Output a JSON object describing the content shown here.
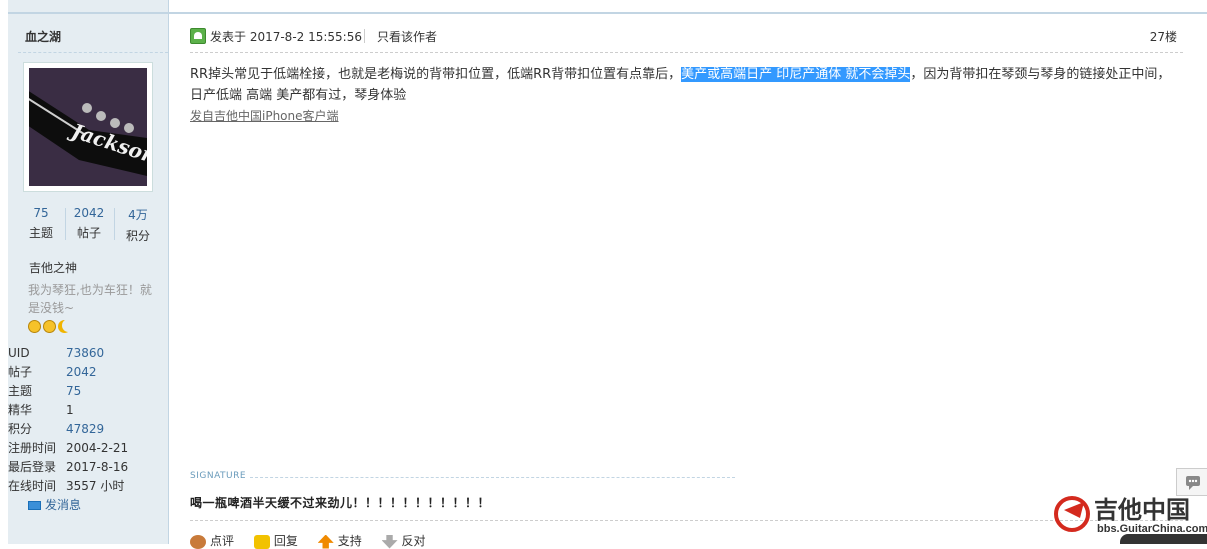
{
  "sidebar": {
    "username": "血之湖",
    "stats": [
      {
        "value": "75",
        "label": "主题"
      },
      {
        "value": "2042",
        "label": "帖子"
      },
      {
        "value": "4万",
        "label": "积分"
      }
    ],
    "rank": "吉他之神",
    "motto": "我为琴狂,也为车狂！就是没钱~",
    "avatar_text": "Jackson",
    "info": [
      {
        "key": "UID",
        "value": "73860"
      },
      {
        "key": "帖子",
        "value": "2042"
      },
      {
        "key": "主题",
        "value": "75"
      },
      {
        "key": "精华",
        "value": "1"
      },
      {
        "key": "积分",
        "value": "47829"
      },
      {
        "key": "注册时间",
        "value": "2004-2-21"
      },
      {
        "key": "最后登录",
        "value": "2017-8-16"
      },
      {
        "key": "在线时间",
        "value": "3557 小时"
      }
    ],
    "send_message": "发消息"
  },
  "post": {
    "posted_at": "发表于 2017-8-2 15:55:56",
    "only_author": "只看该作者",
    "floor": "27楼",
    "content_before": "RR掉头常见于低端栓接，也就是老梅说的背带扣位置，低端RR背带扣位置有点靠后，",
    "content_highlight": "美产或高端日产 印尼产通体 就不会掉头",
    "content_after": "，因为背带扣在琴颈与琴身的链接处正中间，日产低端 高端 美产都有过，琴身体验",
    "source": "发自吉他中国iPhone客户端",
    "signature_label": "SIGNATURE",
    "signature": "喝一瓶啤酒半天缓不过来劲儿！！！！！！！！！！！",
    "actions": [
      "点评",
      "回复",
      "支持",
      "反对"
    ]
  },
  "watermark": {
    "title": "吉他中国",
    "url": "bbs.GuitarChina.com"
  },
  "colors": {
    "sidebar_bg": "#e5edf2",
    "link": "#336699",
    "highlight": "#3399ff"
  }
}
